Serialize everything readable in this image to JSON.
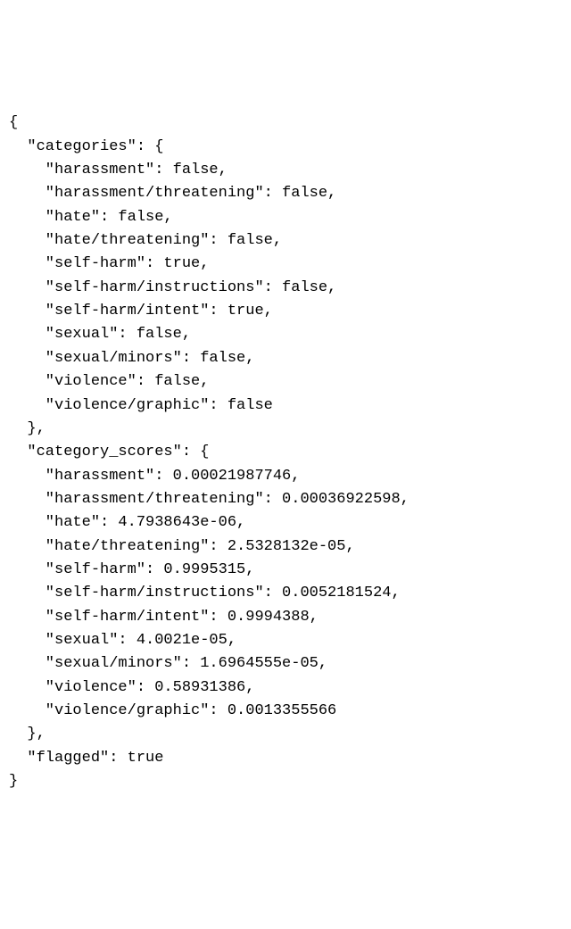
{
  "json_code": {
    "open": "{",
    "categories_key": "  \"categories\": {",
    "categories": {
      "harassment": "    \"harassment\": false,",
      "harassment_threatening": "    \"harassment/threatening\": false,",
      "hate": "    \"hate\": false,",
      "hate_threatening": "    \"hate/threatening\": false,",
      "self_harm": "    \"self-harm\": true,",
      "self_harm_instructions": "    \"self-harm/instructions\": false,",
      "self_harm_intent": "    \"self-harm/intent\": true,",
      "sexual": "    \"sexual\": false,",
      "sexual_minors": "    \"sexual/minors\": false,",
      "violence": "    \"violence\": false,",
      "violence_graphic": "    \"violence/graphic\": false"
    },
    "categories_close": "  },",
    "scores_key": "  \"category_scores\": {",
    "scores": {
      "harassment": "    \"harassment\": 0.00021987746,",
      "harassment_threatening": "    \"harassment/threatening\": 0.00036922598,",
      "hate": "    \"hate\": 4.7938643e-06,",
      "hate_threatening": "    \"hate/threatening\": 2.5328132e-05,",
      "self_harm": "    \"self-harm\": 0.9995315,",
      "self_harm_instructions": "    \"self-harm/instructions\": 0.0052181524,",
      "self_harm_intent": "    \"self-harm/intent\": 0.9994388,",
      "sexual": "    \"sexual\": 4.0021e-05,",
      "sexual_minors": "    \"sexual/minors\": 1.6964555e-05,",
      "violence": "    \"violence\": 0.58931386,",
      "violence_graphic": "    \"violence/graphic\": 0.0013355566"
    },
    "scores_close": "  },",
    "flagged": "  \"flagged\": true",
    "close": "}"
  }
}
